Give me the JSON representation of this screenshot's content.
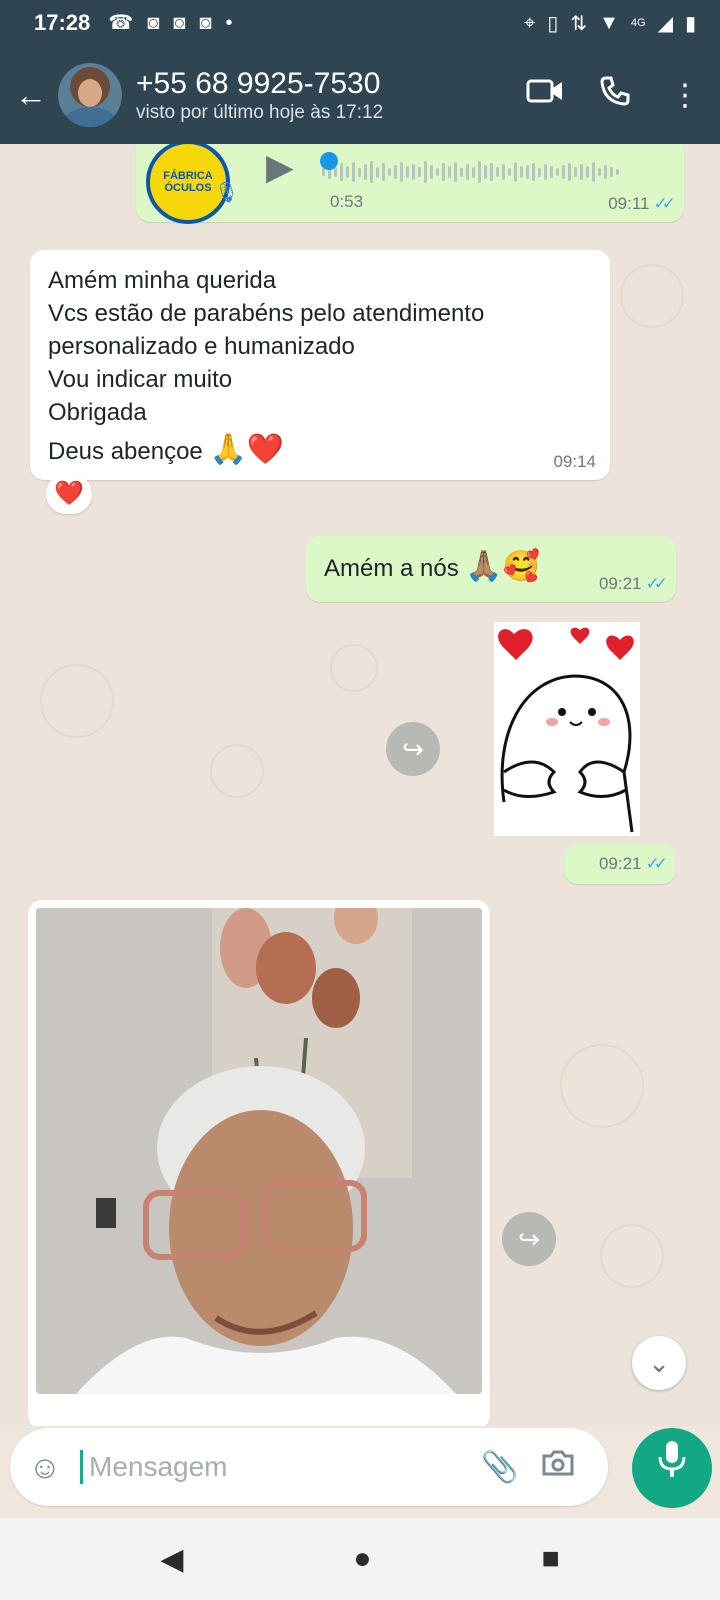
{
  "status_bar": {
    "time": "17:28",
    "network": "4G",
    "icons": [
      "missed-call-icon",
      "instagram-icon",
      "instagram-icon",
      "instagram-icon",
      "dot-icon",
      "location-icon",
      "vibrate-icon",
      "data-arrows-icon",
      "wifi-icon",
      "signal-icon",
      "battery-icon"
    ]
  },
  "header": {
    "contact_name": "+55 68 9925-7530",
    "last_seen": "visto por último hoje às 17:12",
    "icons": [
      "back-arrow-icon",
      "video-call-icon",
      "phone-icon",
      "more-vert-icon"
    ]
  },
  "messages": {
    "voice": {
      "duration": "0:53",
      "time": "09:11",
      "avatar_text": "FÁBRICA ÓCULOS"
    },
    "text_in": {
      "lines": [
        "Amém minha querida",
        "Vcs estão de parabéns pelo atendimento",
        "personalizado e humanizado",
        "Vou indicar muito",
        "Obrigada",
        "Deus abençoe"
      ],
      "emoji": "🙏❤️",
      "time": "09:14",
      "reaction": "❤️"
    },
    "text_out": {
      "text": "Amém a nós",
      "emoji": "🙏🏽🥰",
      "time": "09:21"
    },
    "sticker": {
      "time": "09:21"
    }
  },
  "composer": {
    "placeholder": "Mensagem",
    "icons": [
      "emoji-icon",
      "attach-icon",
      "camera-icon",
      "mic-icon"
    ]
  },
  "colors": {
    "header_bg": "#2f4652",
    "outgoing_bubble": "#dcf8c6",
    "incoming_bubble": "#ffffff",
    "accent_green": "#13a884",
    "read_ticks": "#4aa6e8"
  }
}
